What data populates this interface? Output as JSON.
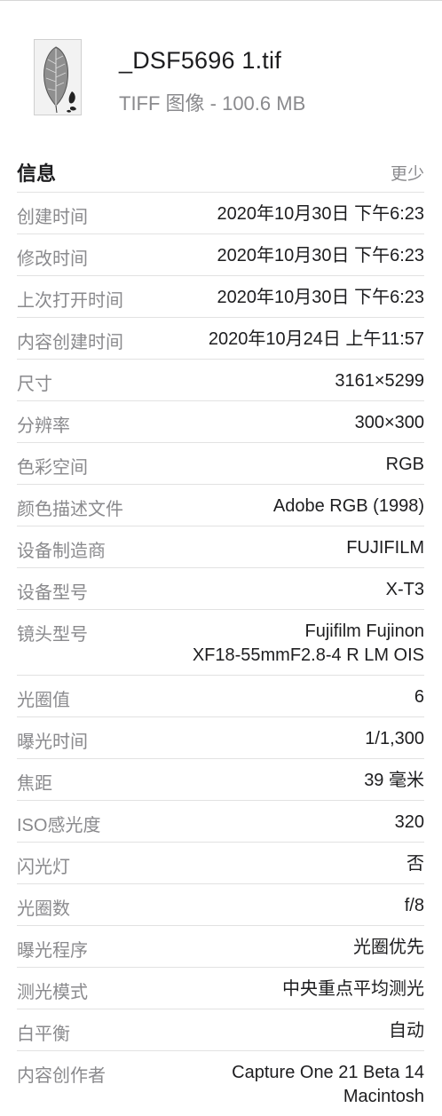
{
  "file": {
    "name": "_DSF5696 1.tif",
    "kind": "TIFF 图像 - 100.6 MB"
  },
  "info": {
    "title": "信息",
    "less_label": "更少",
    "rows": [
      {
        "label": "创建时间",
        "value": "2020年10月30日 下午6:23"
      },
      {
        "label": "修改时间",
        "value": "2020年10月30日 下午6:23"
      },
      {
        "label": "上次打开时间",
        "value": "2020年10月30日 下午6:23"
      },
      {
        "label": "内容创建时间",
        "value": "2020年10月24日 上午11:57"
      },
      {
        "label": "尺寸",
        "value": "3161×5299"
      },
      {
        "label": "分辨率",
        "value": "300×300"
      },
      {
        "label": "色彩空间",
        "value": "RGB"
      },
      {
        "label": "颜色描述文件",
        "value": "Adobe RGB (1998)"
      },
      {
        "label": "设备制造商",
        "value": "FUJIFILM"
      },
      {
        "label": "设备型号",
        "value": "X-T3"
      },
      {
        "label": "镜头型号",
        "value": "Fujifilm Fujinon",
        "value2": "XF18-55mmF2.8-4 R LM OIS"
      },
      {
        "label": "光圈值",
        "value": "6"
      },
      {
        "label": "曝光时间",
        "value": "1/1,300"
      },
      {
        "label": "焦距",
        "value": "39 毫米"
      },
      {
        "label": "ISO感光度",
        "value": "320"
      },
      {
        "label": "闪光灯",
        "value": "否"
      },
      {
        "label": "光圈数",
        "value": "f/8"
      },
      {
        "label": "曝光程序",
        "value": "光圈优先"
      },
      {
        "label": "测光模式",
        "value": "中央重点平均测光"
      },
      {
        "label": "白平衡",
        "value": "自动"
      },
      {
        "label": "内容创作者",
        "value": "Capture One 21 Beta 14",
        "value2": "Macintosh"
      }
    ]
  },
  "colors": {
    "label": "#8a8a8d",
    "value": "#1d1d1f",
    "divider": "#e2e2e2"
  },
  "icons": {
    "thumbnail": "leaf-photo-thumbnail"
  }
}
